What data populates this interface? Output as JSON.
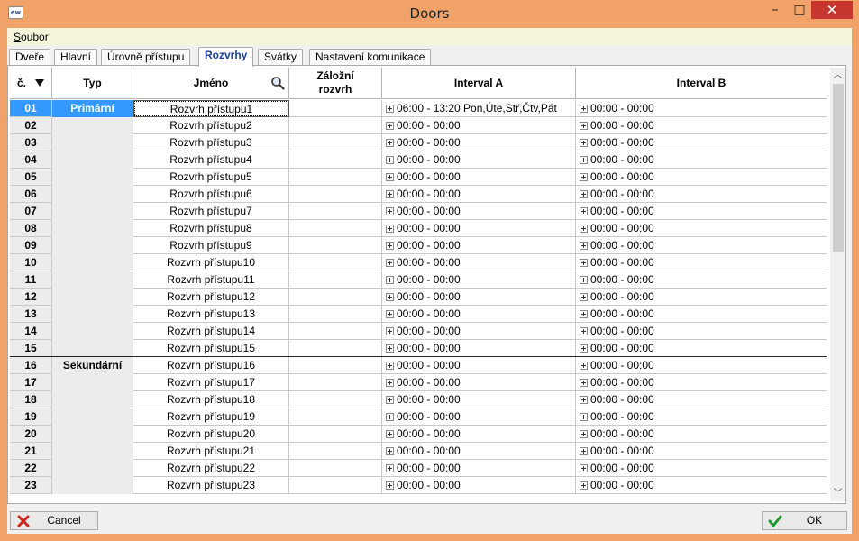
{
  "window": {
    "title": "Doors",
    "icon_text": "ew",
    "minimize_glyph": "–",
    "maximize_glyph": "□",
    "close_glyph": "✕"
  },
  "menu": {
    "file_first": "S",
    "file_rest": "oubor"
  },
  "tabs": [
    {
      "label": "Dveře"
    },
    {
      "label": "Hlavní"
    },
    {
      "label": "Úrovně přístupu"
    },
    {
      "label": "Rozvrhy"
    },
    {
      "label": "Svátky"
    },
    {
      "label": "Nastavení komunikace"
    }
  ],
  "active_tab": "Rozvrhy",
  "grid": {
    "headers": {
      "num": "č.",
      "type": "Typ",
      "name": "Jméno",
      "backup_line1": "Záložní",
      "backup_line2": "rozvrh",
      "interval_a": "Interval A",
      "interval_b": "Interval B"
    },
    "groups": [
      {
        "label": "Primární",
        "first_row": 0,
        "count": 15
      },
      {
        "label": "Sekundární",
        "first_row": 15,
        "count": 8
      }
    ],
    "rows": [
      {
        "num": "01",
        "name": "Rozvrh přístupu1",
        "backup": "",
        "interval_a": "06:00 - 13:20 Pon,Úte,Stř,Čtv,Pát",
        "interval_b": "00:00 - 00:00"
      },
      {
        "num": "02",
        "name": "Rozvrh přístupu2",
        "backup": "",
        "interval_a": "00:00 - 00:00",
        "interval_b": "00:00 - 00:00"
      },
      {
        "num": "03",
        "name": "Rozvrh přístupu3",
        "backup": "",
        "interval_a": "00:00 - 00:00",
        "interval_b": "00:00 - 00:00"
      },
      {
        "num": "04",
        "name": "Rozvrh přístupu4",
        "backup": "",
        "interval_a": "00:00 - 00:00",
        "interval_b": "00:00 - 00:00"
      },
      {
        "num": "05",
        "name": "Rozvrh přístupu5",
        "backup": "",
        "interval_a": "00:00 - 00:00",
        "interval_b": "00:00 - 00:00"
      },
      {
        "num": "06",
        "name": "Rozvrh přístupu6",
        "backup": "",
        "interval_a": "00:00 - 00:00",
        "interval_b": "00:00 - 00:00"
      },
      {
        "num": "07",
        "name": "Rozvrh přístupu7",
        "backup": "",
        "interval_a": "00:00 - 00:00",
        "interval_b": "00:00 - 00:00"
      },
      {
        "num": "08",
        "name": "Rozvrh přístupu8",
        "backup": "",
        "interval_a": "00:00 - 00:00",
        "interval_b": "00:00 - 00:00"
      },
      {
        "num": "09",
        "name": "Rozvrh přístupu9",
        "backup": "",
        "interval_a": "00:00 - 00:00",
        "interval_b": "00:00 - 00:00"
      },
      {
        "num": "10",
        "name": "Rozvrh přístupu10",
        "backup": "",
        "interval_a": "00:00 - 00:00",
        "interval_b": "00:00 - 00:00"
      },
      {
        "num": "11",
        "name": "Rozvrh přístupu11",
        "backup": "",
        "interval_a": "00:00 - 00:00",
        "interval_b": "00:00 - 00:00"
      },
      {
        "num": "12",
        "name": "Rozvrh přístupu12",
        "backup": "",
        "interval_a": "00:00 - 00:00",
        "interval_b": "00:00 - 00:00"
      },
      {
        "num": "13",
        "name": "Rozvrh přístupu13",
        "backup": "",
        "interval_a": "00:00 - 00:00",
        "interval_b": "00:00 - 00:00"
      },
      {
        "num": "14",
        "name": "Rozvrh přístupu14",
        "backup": "",
        "interval_a": "00:00 - 00:00",
        "interval_b": "00:00 - 00:00"
      },
      {
        "num": "15",
        "name": "Rozvrh přístupu15",
        "backup": "",
        "interval_a": "00:00 - 00:00",
        "interval_b": "00:00 - 00:00"
      },
      {
        "num": "16",
        "name": "Rozvrh přístupu16",
        "backup": "",
        "interval_a": "00:00 - 00:00",
        "interval_b": "00:00 - 00:00"
      },
      {
        "num": "17",
        "name": "Rozvrh přístupu17",
        "backup": "",
        "interval_a": "00:00 - 00:00",
        "interval_b": "00:00 - 00:00"
      },
      {
        "num": "18",
        "name": "Rozvrh přístupu18",
        "backup": "",
        "interval_a": "00:00 - 00:00",
        "interval_b": "00:00 - 00:00"
      },
      {
        "num": "19",
        "name": "Rozvrh přístupu19",
        "backup": "",
        "interval_a": "00:00 - 00:00",
        "interval_b": "00:00 - 00:00"
      },
      {
        "num": "20",
        "name": "Rozvrh přístupu20",
        "backup": "",
        "interval_a": "00:00 - 00:00",
        "interval_b": "00:00 - 00:00"
      },
      {
        "num": "21",
        "name": "Rozvrh přístupu21",
        "backup": "",
        "interval_a": "00:00 - 00:00",
        "interval_b": "00:00 - 00:00"
      },
      {
        "num": "22",
        "name": "Rozvrh přístupu22",
        "backup": "",
        "interval_a": "00:00 - 00:00",
        "interval_b": "00:00 - 00:00"
      },
      {
        "num": "23",
        "name": "Rozvrh přístupu23",
        "backup": "",
        "interval_a": "00:00 - 00:00",
        "interval_b": "00:00 - 00:00"
      }
    ],
    "selected_row": "01"
  },
  "buttons": {
    "cancel": {
      "label": "Cancel",
      "icon": "red-x-icon",
      "color": "#d2261c"
    },
    "ok": {
      "label": "OK",
      "icon": "green-check-icon",
      "color": "#1f9a2e"
    }
  },
  "colors": {
    "frame": "#f0a268",
    "selection": "#3399ff",
    "close_button": "#c7372f",
    "active_tab_text": "#1a3fa0"
  }
}
